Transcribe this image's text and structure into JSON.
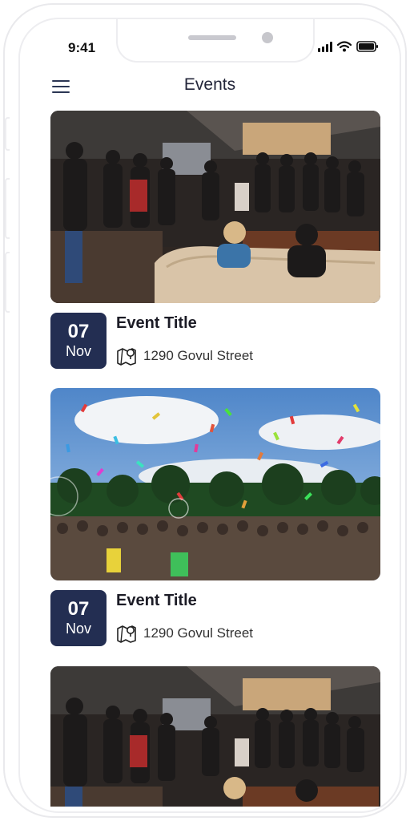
{
  "status_bar": {
    "time": "9:41"
  },
  "header": {
    "title": "Events"
  },
  "events": [
    {
      "title": "Event Title",
      "day": "07",
      "month": "Nov",
      "address": "1290 Govul Street",
      "image": "indoor-crowd-photo"
    },
    {
      "title": "Event Title",
      "day": "07",
      "month": "Nov",
      "address": "1290 Govul Street",
      "image": "confetti-festival-photo"
    },
    {
      "image": "indoor-crowd-photo"
    }
  ],
  "icons": {
    "menu": "hamburger-menu-icon",
    "map": "map-pin-icon",
    "signal": "cellular-signal-icon",
    "wifi": "wifi-icon",
    "battery": "battery-icon"
  },
  "colors": {
    "badge": "#232e52",
    "accent_text": "#1c1c26"
  }
}
